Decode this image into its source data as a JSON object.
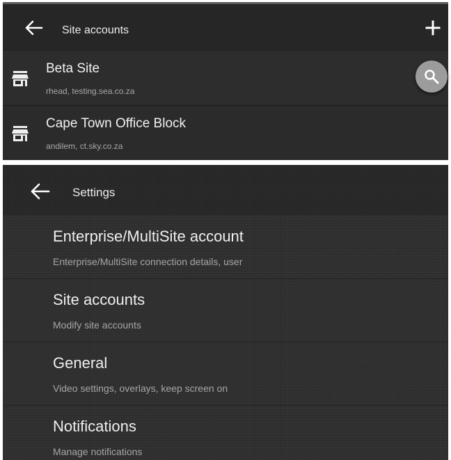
{
  "site_accounts": {
    "header": {
      "title": "Site accounts",
      "back_icon": "arrow-back-icon",
      "add_icon": "plus-icon"
    },
    "accounts": [
      {
        "name": "Beta Site",
        "details": "rhead, testing.sea.co.za",
        "icon": "store-icon"
      },
      {
        "name": "Cape Town Office Block",
        "details": "andilem, ct.sky.co.za",
        "icon": "store-icon"
      }
    ],
    "fab_icon": "search-icon"
  },
  "settings": {
    "header": {
      "title": "Settings",
      "back_icon": "arrow-back-icon"
    },
    "items": [
      {
        "title": "Enterprise/MultiSite account",
        "subtitle": "Enterprise/MultiSite connection details, user"
      },
      {
        "title": "Site accounts",
        "subtitle": "Modify site accounts"
      },
      {
        "title": "General",
        "subtitle": "Video settings, overlays, keep screen on"
      },
      {
        "title": "Notifications",
        "subtitle": "Manage notifications"
      }
    ]
  },
  "colors": {
    "background_dark": "#2d2d2d",
    "header_dark": "#262626",
    "text_primary": "#f2f2f2",
    "text_secondary": "#a8a8a8",
    "fab_gray": "#9c9c9c"
  }
}
